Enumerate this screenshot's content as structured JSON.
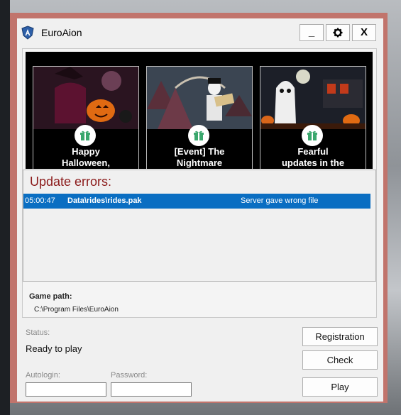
{
  "app": {
    "title": "EuroAion"
  },
  "window_buttons": {
    "minimize": "_",
    "close": "X",
    "settings_icon": "gear-icon"
  },
  "news": [
    {
      "title_lines": [
        "Happy",
        "Halloween,"
      ],
      "icon": "gift-icon"
    },
    {
      "title_lines": [
        "[Event] The",
        "Nightmare"
      ],
      "icon": "gift-icon"
    },
    {
      "title_lines": [
        "Fearful",
        "updates in the"
      ],
      "icon": "gift-icon"
    }
  ],
  "errors": {
    "title": "Update errors:",
    "rows": [
      {
        "time": "05:00:47",
        "file": "Data\\rides\\rides.pak",
        "message": "Server gave wrong file"
      }
    ]
  },
  "game_path": {
    "label": "Game path:",
    "value": "C:\\Program Files\\EuroAion"
  },
  "status": {
    "label": "Status:",
    "value": "Ready to play"
  },
  "autologin": {
    "label": "Autologin:",
    "value": ""
  },
  "password": {
    "label": "Password:",
    "value": ""
  },
  "buttons": {
    "registration": "Registration",
    "check": "Check",
    "play": "Play"
  },
  "colors": {
    "frame": "#c1746c",
    "selection": "#0a6ec2",
    "error_title": "#8b1a1a",
    "gift": "#3aa76d"
  }
}
